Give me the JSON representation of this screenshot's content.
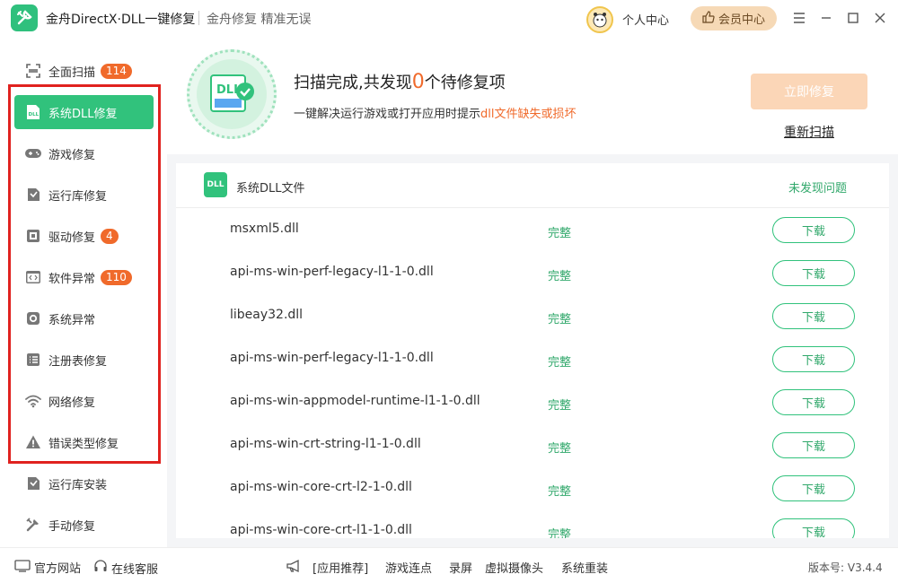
{
  "titlebar": {
    "app_title": "金舟DirectX·DLL一键修复",
    "slogan": "金舟修复 精准无误",
    "personal_center": "个人中心",
    "member_center": "会员中心"
  },
  "sidebar": {
    "items": [
      {
        "label": "全面扫描",
        "badge": "114"
      },
      {
        "label": "系统DLL修复",
        "badge": ""
      },
      {
        "label": "游戏修复",
        "badge": ""
      },
      {
        "label": "运行库修复",
        "badge": ""
      },
      {
        "label": "驱动修复",
        "badge": "4"
      },
      {
        "label": "软件异常",
        "badge": "110"
      },
      {
        "label": "系统异常",
        "badge": ""
      },
      {
        "label": "注册表修复",
        "badge": ""
      },
      {
        "label": "网络修复",
        "badge": ""
      },
      {
        "label": "错误类型修复",
        "badge": ""
      },
      {
        "label": "运行库安装",
        "badge": ""
      },
      {
        "label": "手动修复",
        "badge": ""
      }
    ]
  },
  "scan": {
    "title_pre": "扫描完成,共发现",
    "count": "0",
    "title_post": "个待修复项",
    "sub_pre": "一键解决运行游戏或打开应用时提示",
    "sub_highlight": "dll文件缺失或损坏",
    "fix_button": "立即修复",
    "rescan": "重新扫描",
    "icon_text": "DLL"
  },
  "list": {
    "icon_text": "DLL",
    "title": "系统DLL文件",
    "status": "未发现问题",
    "rows": [
      {
        "name": "msxml5.dll",
        "status": "完整",
        "action": "下载"
      },
      {
        "name": "api-ms-win-perf-legacy-l1-1-0.dll",
        "status": "完整",
        "action": "下载"
      },
      {
        "name": "libeay32.dll",
        "status": "完整",
        "action": "下载"
      },
      {
        "name": "api-ms-win-perf-legacy-l1-1-0.dll",
        "status": "完整",
        "action": "下载"
      },
      {
        "name": "api-ms-win-appmodel-runtime-l1-1-0.dll",
        "status": "完整",
        "action": "下载"
      },
      {
        "name": "api-ms-win-crt-string-l1-1-0.dll",
        "status": "完整",
        "action": "下载"
      },
      {
        "name": "api-ms-win-core-crt-l2-1-0.dll",
        "status": "完整",
        "action": "下载"
      },
      {
        "name": "api-ms-win-core-crt-l1-1-0.dll",
        "status": "完整",
        "action": "下载"
      }
    ]
  },
  "footer": {
    "official_site": "官方网站",
    "online_service": "在线客服",
    "recommend": "[应用推荐]",
    "apps": [
      "游戏连点",
      "录屏",
      "虚拟摄像头",
      "系统重装"
    ],
    "version": "版本号: V3.4.4"
  },
  "colors": {
    "accent": "#31c27c",
    "highlight": "#f06a2b",
    "annotation_frame": "#e0221f"
  }
}
